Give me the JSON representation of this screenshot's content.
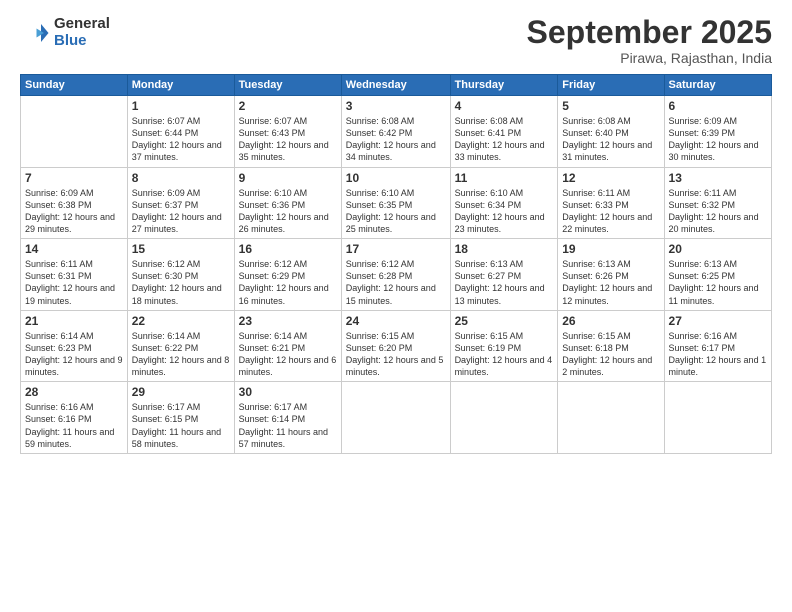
{
  "logo": {
    "general": "General",
    "blue": "Blue"
  },
  "title": "September 2025",
  "subtitle": "Pirawa, Rajasthan, India",
  "weekdays": [
    "Sunday",
    "Monday",
    "Tuesday",
    "Wednesday",
    "Thursday",
    "Friday",
    "Saturday"
  ],
  "weeks": [
    [
      {
        "day": "",
        "sunrise": "",
        "sunset": "",
        "daylight": ""
      },
      {
        "day": "1",
        "sunrise": "Sunrise: 6:07 AM",
        "sunset": "Sunset: 6:44 PM",
        "daylight": "Daylight: 12 hours and 37 minutes."
      },
      {
        "day": "2",
        "sunrise": "Sunrise: 6:07 AM",
        "sunset": "Sunset: 6:43 PM",
        "daylight": "Daylight: 12 hours and 35 minutes."
      },
      {
        "day": "3",
        "sunrise": "Sunrise: 6:08 AM",
        "sunset": "Sunset: 6:42 PM",
        "daylight": "Daylight: 12 hours and 34 minutes."
      },
      {
        "day": "4",
        "sunrise": "Sunrise: 6:08 AM",
        "sunset": "Sunset: 6:41 PM",
        "daylight": "Daylight: 12 hours and 33 minutes."
      },
      {
        "day": "5",
        "sunrise": "Sunrise: 6:08 AM",
        "sunset": "Sunset: 6:40 PM",
        "daylight": "Daylight: 12 hours and 31 minutes."
      },
      {
        "day": "6",
        "sunrise": "Sunrise: 6:09 AM",
        "sunset": "Sunset: 6:39 PM",
        "daylight": "Daylight: 12 hours and 30 minutes."
      }
    ],
    [
      {
        "day": "7",
        "sunrise": "Sunrise: 6:09 AM",
        "sunset": "Sunset: 6:38 PM",
        "daylight": "Daylight: 12 hours and 29 minutes."
      },
      {
        "day": "8",
        "sunrise": "Sunrise: 6:09 AM",
        "sunset": "Sunset: 6:37 PM",
        "daylight": "Daylight: 12 hours and 27 minutes."
      },
      {
        "day": "9",
        "sunrise": "Sunrise: 6:10 AM",
        "sunset": "Sunset: 6:36 PM",
        "daylight": "Daylight: 12 hours and 26 minutes."
      },
      {
        "day": "10",
        "sunrise": "Sunrise: 6:10 AM",
        "sunset": "Sunset: 6:35 PM",
        "daylight": "Daylight: 12 hours and 25 minutes."
      },
      {
        "day": "11",
        "sunrise": "Sunrise: 6:10 AM",
        "sunset": "Sunset: 6:34 PM",
        "daylight": "Daylight: 12 hours and 23 minutes."
      },
      {
        "day": "12",
        "sunrise": "Sunrise: 6:11 AM",
        "sunset": "Sunset: 6:33 PM",
        "daylight": "Daylight: 12 hours and 22 minutes."
      },
      {
        "day": "13",
        "sunrise": "Sunrise: 6:11 AM",
        "sunset": "Sunset: 6:32 PM",
        "daylight": "Daylight: 12 hours and 20 minutes."
      }
    ],
    [
      {
        "day": "14",
        "sunrise": "Sunrise: 6:11 AM",
        "sunset": "Sunset: 6:31 PM",
        "daylight": "Daylight: 12 hours and 19 minutes."
      },
      {
        "day": "15",
        "sunrise": "Sunrise: 6:12 AM",
        "sunset": "Sunset: 6:30 PM",
        "daylight": "Daylight: 12 hours and 18 minutes."
      },
      {
        "day": "16",
        "sunrise": "Sunrise: 6:12 AM",
        "sunset": "Sunset: 6:29 PM",
        "daylight": "Daylight: 12 hours and 16 minutes."
      },
      {
        "day": "17",
        "sunrise": "Sunrise: 6:12 AM",
        "sunset": "Sunset: 6:28 PM",
        "daylight": "Daylight: 12 hours and 15 minutes."
      },
      {
        "day": "18",
        "sunrise": "Sunrise: 6:13 AM",
        "sunset": "Sunset: 6:27 PM",
        "daylight": "Daylight: 12 hours and 13 minutes."
      },
      {
        "day": "19",
        "sunrise": "Sunrise: 6:13 AM",
        "sunset": "Sunset: 6:26 PM",
        "daylight": "Daylight: 12 hours and 12 minutes."
      },
      {
        "day": "20",
        "sunrise": "Sunrise: 6:13 AM",
        "sunset": "Sunset: 6:25 PM",
        "daylight": "Daylight: 12 hours and 11 minutes."
      }
    ],
    [
      {
        "day": "21",
        "sunrise": "Sunrise: 6:14 AM",
        "sunset": "Sunset: 6:23 PM",
        "daylight": "Daylight: 12 hours and 9 minutes."
      },
      {
        "day": "22",
        "sunrise": "Sunrise: 6:14 AM",
        "sunset": "Sunset: 6:22 PM",
        "daylight": "Daylight: 12 hours and 8 minutes."
      },
      {
        "day": "23",
        "sunrise": "Sunrise: 6:14 AM",
        "sunset": "Sunset: 6:21 PM",
        "daylight": "Daylight: 12 hours and 6 minutes."
      },
      {
        "day": "24",
        "sunrise": "Sunrise: 6:15 AM",
        "sunset": "Sunset: 6:20 PM",
        "daylight": "Daylight: 12 hours and 5 minutes."
      },
      {
        "day": "25",
        "sunrise": "Sunrise: 6:15 AM",
        "sunset": "Sunset: 6:19 PM",
        "daylight": "Daylight: 12 hours and 4 minutes."
      },
      {
        "day": "26",
        "sunrise": "Sunrise: 6:15 AM",
        "sunset": "Sunset: 6:18 PM",
        "daylight": "Daylight: 12 hours and 2 minutes."
      },
      {
        "day": "27",
        "sunrise": "Sunrise: 6:16 AM",
        "sunset": "Sunset: 6:17 PM",
        "daylight": "Daylight: 12 hours and 1 minute."
      }
    ],
    [
      {
        "day": "28",
        "sunrise": "Sunrise: 6:16 AM",
        "sunset": "Sunset: 6:16 PM",
        "daylight": "Daylight: 11 hours and 59 minutes."
      },
      {
        "day": "29",
        "sunrise": "Sunrise: 6:17 AM",
        "sunset": "Sunset: 6:15 PM",
        "daylight": "Daylight: 11 hours and 58 minutes."
      },
      {
        "day": "30",
        "sunrise": "Sunrise: 6:17 AM",
        "sunset": "Sunset: 6:14 PM",
        "daylight": "Daylight: 11 hours and 57 minutes."
      },
      {
        "day": "",
        "sunrise": "",
        "sunset": "",
        "daylight": ""
      },
      {
        "day": "",
        "sunrise": "",
        "sunset": "",
        "daylight": ""
      },
      {
        "day": "",
        "sunrise": "",
        "sunset": "",
        "daylight": ""
      },
      {
        "day": "",
        "sunrise": "",
        "sunset": "",
        "daylight": ""
      }
    ]
  ]
}
